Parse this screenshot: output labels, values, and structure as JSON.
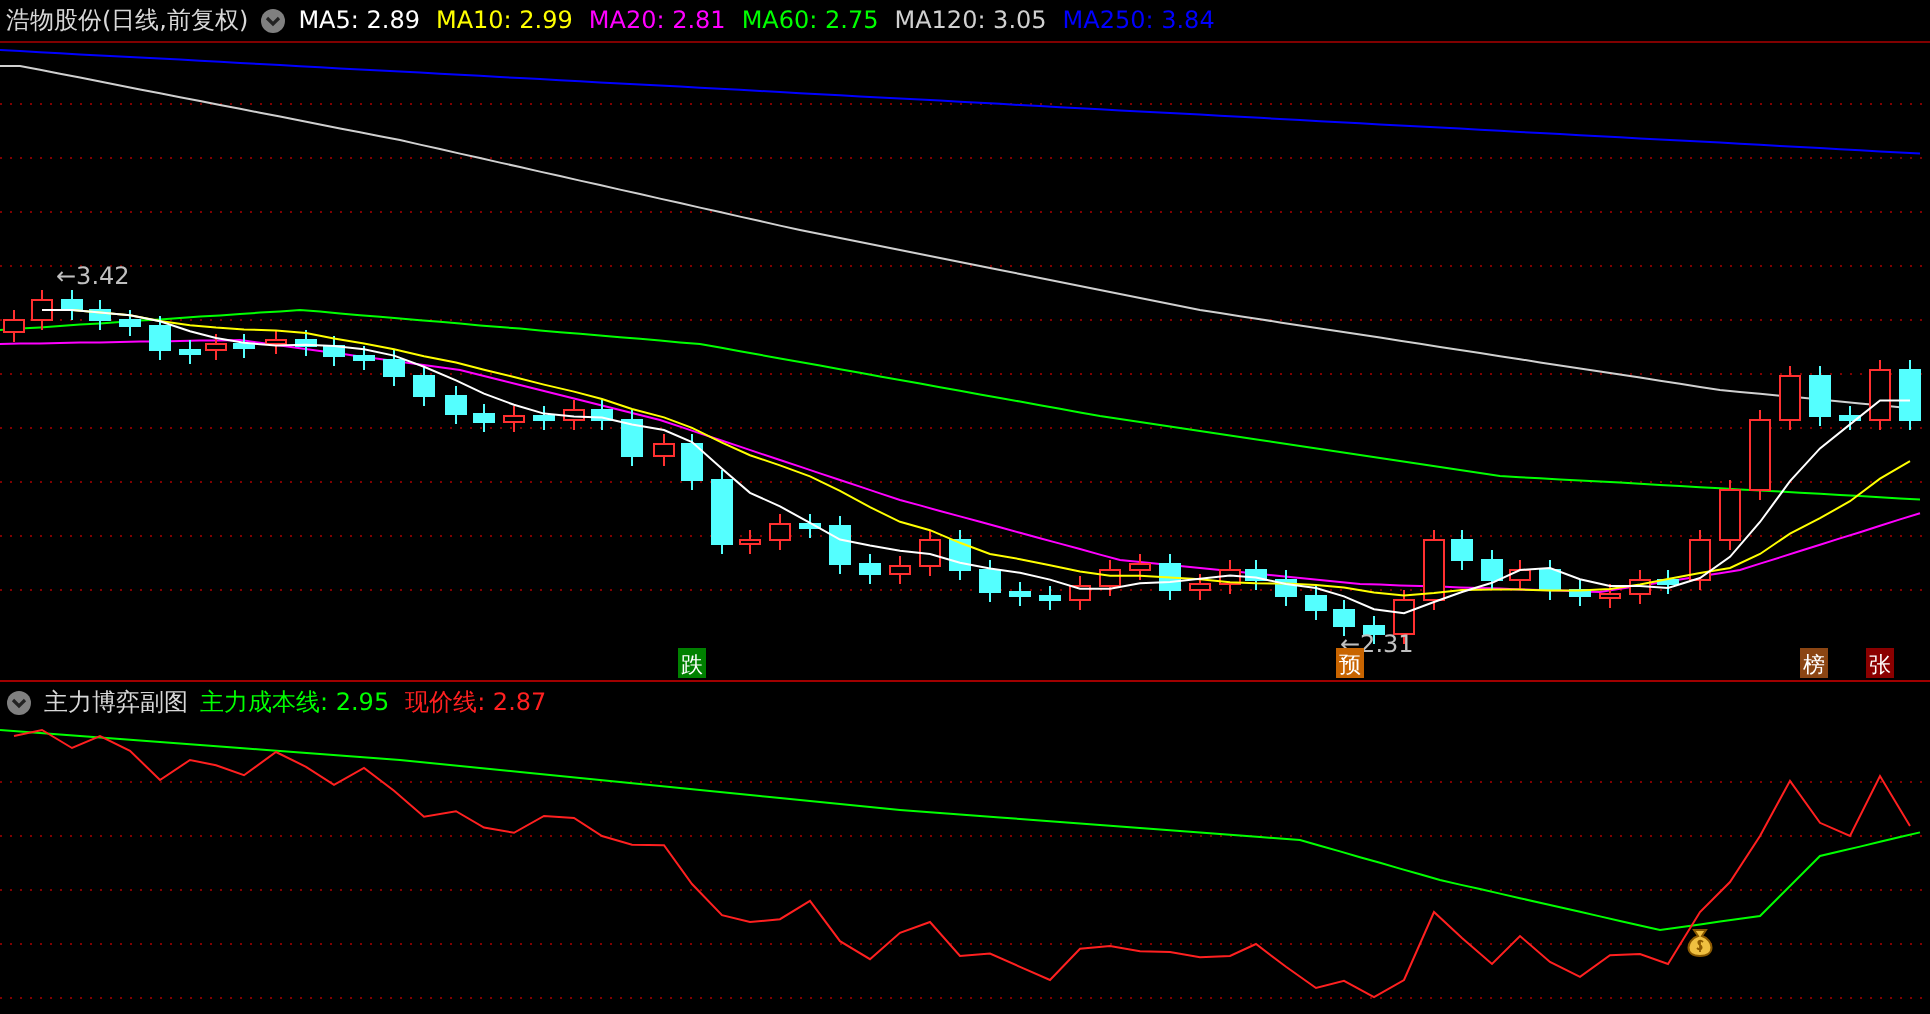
{
  "main_chart": {
    "title": "浩物股份(日线,前复权)",
    "indicators": [
      {
        "label": "MA5: 2.89",
        "color": "#ffffff"
      },
      {
        "label": "MA10: 2.99",
        "color": "#ffff00"
      },
      {
        "label": "MA20: 2.81",
        "color": "#ff00ff"
      },
      {
        "label": "MA60: 2.75",
        "color": "#00ff00"
      },
      {
        "label": "MA120: 3.05",
        "color": "#d0d0d0"
      },
      {
        "label": "MA250: 3.84",
        "color": "#0000ff"
      }
    ],
    "price_labels": [
      "←3.42",
      "←2.31"
    ],
    "markers": [
      {
        "text": "跌",
        "color": "#008000"
      },
      {
        "text": "预",
        "color": "#c86400"
      },
      {
        "text": "榜",
        "color": "#8b4513"
      },
      {
        "text": "张",
        "color": "#8b0000"
      }
    ]
  },
  "sub_chart": {
    "title": "主力博弈副图",
    "indicators": [
      {
        "label": "主力成本线: 2.95",
        "color": "#00ff00"
      },
      {
        "label": "现价线: 2.87",
        "color": "#ff2020"
      }
    ]
  }
}
